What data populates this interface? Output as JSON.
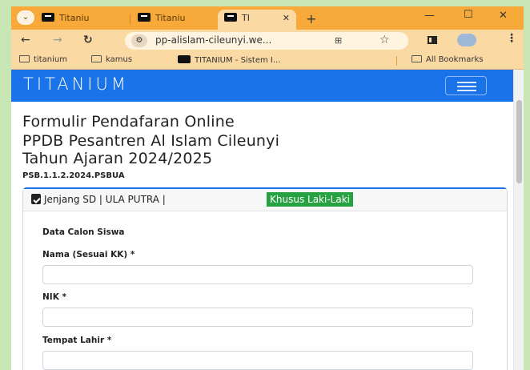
{
  "browser": {
    "tabs": [
      {
        "title": "Titaniu"
      },
      {
        "title": "Titaniu"
      },
      {
        "title": "TI",
        "active": true
      }
    ],
    "url": "pp-alislam-cileunyi.we...",
    "bookmarks": [
      {
        "label": "titanium",
        "type": "folder"
      },
      {
        "label": "kamus",
        "type": "folder"
      },
      {
        "label": "TITANIUM - Sistem I...",
        "type": "site"
      }
    ],
    "all_bookmarks": "All Bookmarks"
  },
  "navbar": {
    "logo": "TITANIUM"
  },
  "page": {
    "title_lines": [
      "Formulir Pendafaran Online",
      "PPDB Pesantren Al Islam Cileunyi",
      "Tahun Ajaran 2024/2025"
    ],
    "code": "PSB.1.1.2.2024.PSBUA",
    "card": {
      "header": "Jenjang SD | ULA PUTRA |",
      "badge": "Khusus Laki-Laki",
      "badge_color": "#27a243",
      "section_title": "Data Calon Siswa",
      "fields": [
        {
          "label": "Nama (Sesuai KK) *",
          "value": ""
        },
        {
          "label": "NIK *",
          "value": ""
        },
        {
          "label": "Tempat Lahir *",
          "value": ""
        }
      ]
    }
  },
  "colors": {
    "accent": "#1a73e8",
    "tabbar": "#f7a93a",
    "toolbar": "#fbd9a3"
  }
}
